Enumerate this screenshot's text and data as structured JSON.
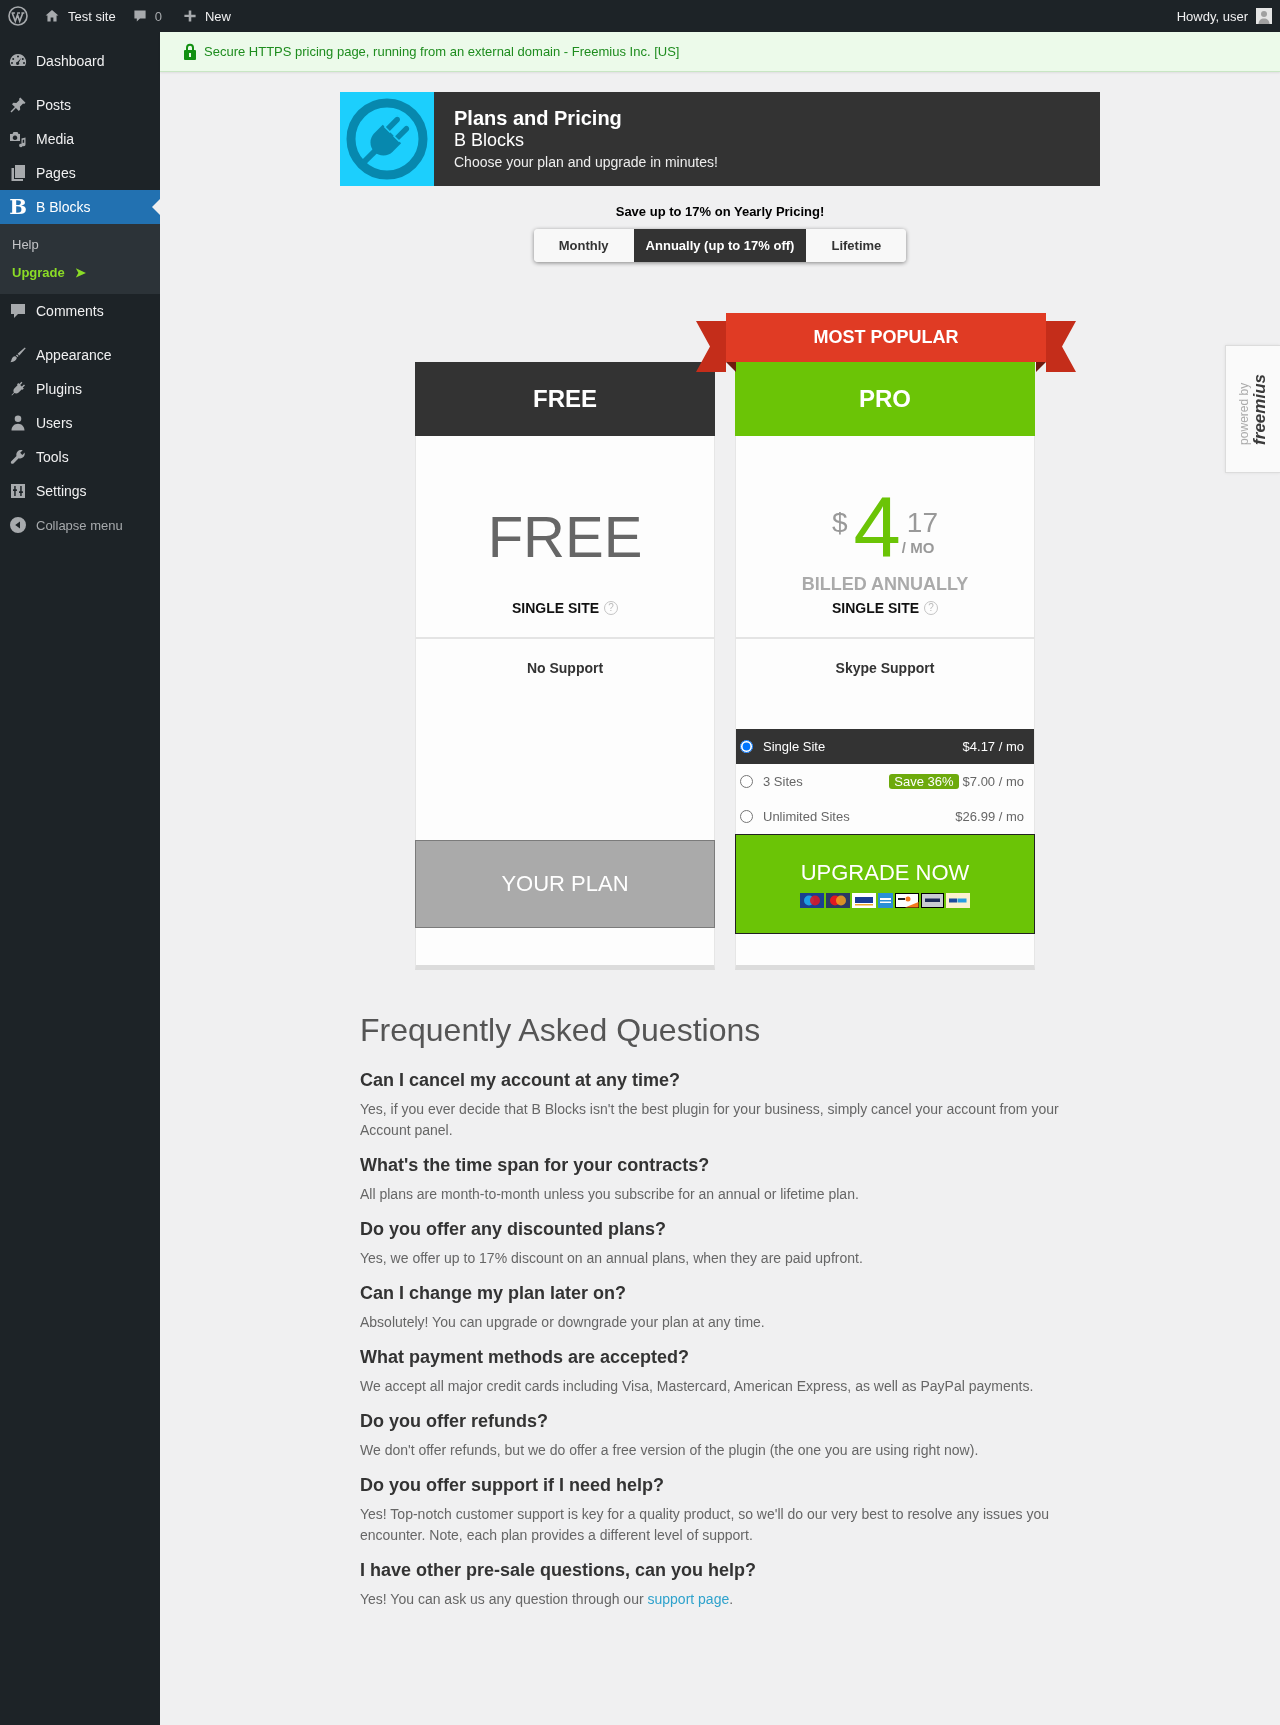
{
  "admin_bar": {
    "site_name": "Test site",
    "comment_count": "0",
    "new_label": "New",
    "greeting": "Howdy, user"
  },
  "sidebar": {
    "groups": [
      {
        "items": [
          {
            "label": "Dashboard",
            "selected": false
          }
        ]
      },
      {
        "items": [
          {
            "label": "Posts",
            "selected": false
          },
          {
            "label": "Media",
            "selected": false
          },
          {
            "label": "Pages",
            "selected": false
          },
          {
            "label": "B Blocks",
            "icon_char": "B",
            "selected": true,
            "submenu": [
              {
                "label": "Help",
                "kind": "link",
                "selected": false
              },
              {
                "label": "Upgrade",
                "suffix": "➤",
                "kind": "upgrade",
                "selected": false
              }
            ]
          },
          {
            "label": "Comments",
            "selected": false
          }
        ]
      },
      {
        "items": [
          {
            "label": "Appearance",
            "selected": false
          },
          {
            "label": "Plugins",
            "selected": false
          },
          {
            "label": "Users",
            "selected": false
          },
          {
            "label": "Tools",
            "selected": false
          },
          {
            "label": "Settings",
            "selected": false
          }
        ]
      }
    ],
    "collapse_label": "Collapse menu"
  },
  "notice": {
    "text": "Secure HTTPS pricing page, running from an external domain - Freemius Inc. [US]"
  },
  "header": {
    "title": "Plans and Pricing",
    "plugin_name": "B Blocks",
    "tagline": "Choose your plan and upgrade in minutes!"
  },
  "billing": {
    "promo": "Save up to 17% on Yearly Pricing!",
    "options": [
      {
        "label": "Monthly",
        "selected": false
      },
      {
        "label": "Annually (up to 17% off)",
        "selected": true
      },
      {
        "label": "Lifetime",
        "selected": false
      }
    ]
  },
  "plans": [
    {
      "kind": "free",
      "name": "FREE",
      "price_label": "FREE",
      "sites": "SINGLE SITE",
      "help_mark": "?",
      "support": "No Support",
      "button": "YOUR PLAN"
    },
    {
      "kind": "paid",
      "ribbon": "MOST POPULAR",
      "name": "PRO",
      "currency": "$",
      "amount": "4",
      "cents": "17",
      "period": "/ MO",
      "billing_note": "BILLED ANNUALLY",
      "sites": "SINGLE SITE",
      "help_mark": "?",
      "support": "Skype Support",
      "licenses": [
        {
          "label": "Single Site",
          "price": "$4.17 / mo",
          "selected": true
        },
        {
          "label": "3 Sites",
          "badge": "Save 36%",
          "price": "$7.00 / mo",
          "selected": false
        },
        {
          "label": "Unlimited Sites",
          "price": "$26.99 / mo",
          "selected": false
        }
      ],
      "button": "UPGRADE NOW"
    }
  ],
  "faq": {
    "title": "Frequently Asked Questions",
    "items": [
      {
        "question": "Can I cancel my account at any time?",
        "answer": "Yes, if you ever decide that B Blocks isn't the best plugin for your business, simply cancel your account from your Account panel."
      },
      {
        "question": "What's the time span for your contracts?",
        "answer": "All plans are month-to-month unless you subscribe for an annual or lifetime plan."
      },
      {
        "question": "Do you offer any discounted plans?",
        "answer": "Yes, we offer up to 17% discount on an annual plans, when they are paid upfront."
      },
      {
        "question": "Can I change my plan later on?",
        "answer": "Absolutely! You can upgrade or downgrade your plan at any time."
      },
      {
        "question": "What payment methods are accepted?",
        "answer": "We accept all major credit cards including Visa, Mastercard, American Express, as well as PayPal payments."
      },
      {
        "question": "Do you offer refunds?",
        "answer": "We don't offer refunds, but we do offer a free version of the plugin (the one you are using right now)."
      },
      {
        "question": "Do you offer support if I need help?",
        "answer": "Yes! Top-notch customer support is key for a quality product, so we'll do our very best to resolve any issues you encounter. Note, each plan provides a different level of support."
      },
      {
        "question": "I have other pre-sale questions, can you help?",
        "answer": "Yes! You can ask us any question through our",
        "link": "support page",
        "after": "."
      }
    ]
  },
  "powered_by": {
    "prefix": "powered by",
    "brand": "freemius"
  }
}
